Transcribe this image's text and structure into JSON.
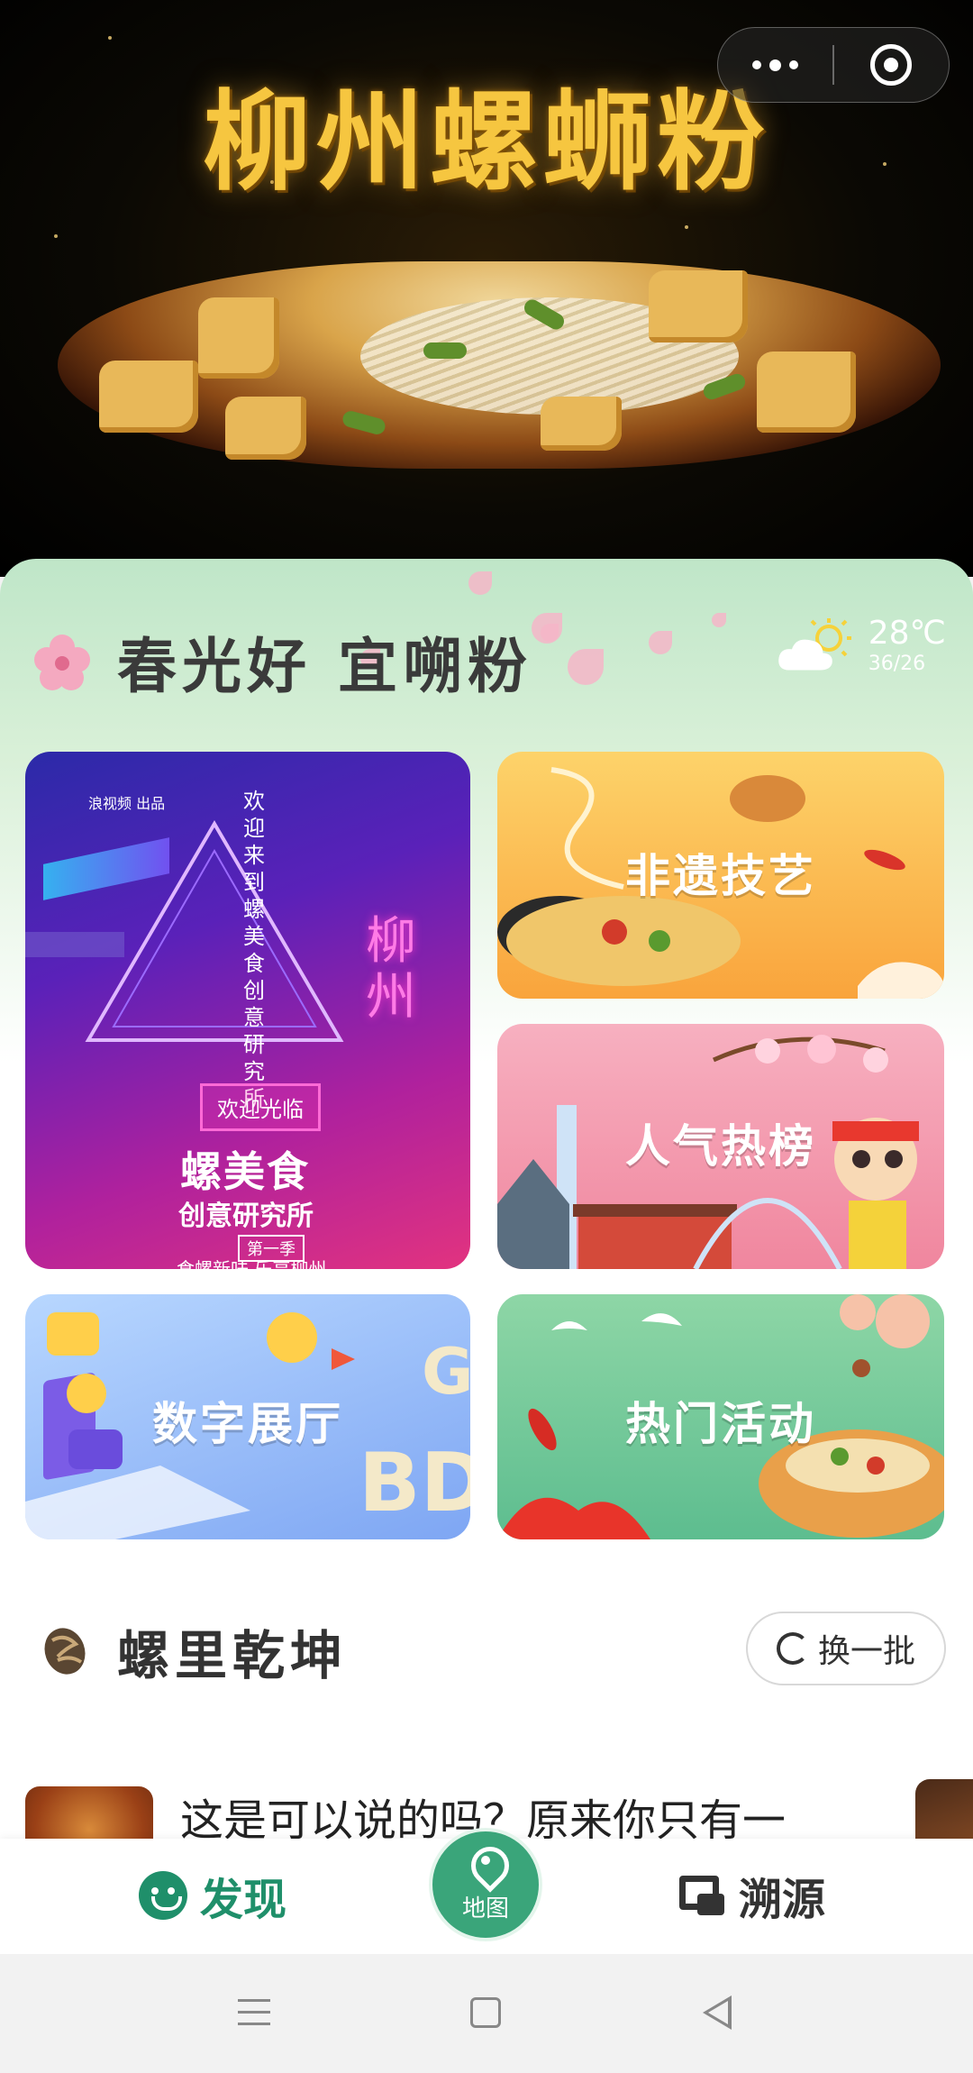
{
  "hero": {
    "title": "柳州螺蛳粉"
  },
  "capsule": {
    "more_icon": "more-dots-icon",
    "close_icon": "target-close-icon"
  },
  "greeting": {
    "text": "春光好 宜嗍粉",
    "weather": {
      "icon": "partly-cloudy-icon",
      "temp": "28℃",
      "range": "36/26"
    }
  },
  "tiles": {
    "banner": {
      "source": "浪视频 出品",
      "vertical_text": "欢迎来到螺美食创意研究所",
      "city": "柳州",
      "welcome": "欢迎光临",
      "title": "螺美食",
      "subtitle": "创意研究所",
      "season": "第一季",
      "slogan": "食螺新味 乐享柳州"
    },
    "craft": {
      "label": "非遗技艺"
    },
    "hot": {
      "label": "人气热榜"
    },
    "digital": {
      "label": "数字展厅"
    },
    "event": {
      "label": "热门活动"
    }
  },
  "section": {
    "title": "螺里乾坤",
    "swap_label": "换一批"
  },
  "news": [
    {
      "title": "这是可以说的吗？原来你只有一"
    }
  ],
  "tabbar": {
    "discover": "发现",
    "map": "地图",
    "trace": "溯源"
  },
  "colors": {
    "brand": "#1f8f6a",
    "map_button": "#3aa57a"
  }
}
